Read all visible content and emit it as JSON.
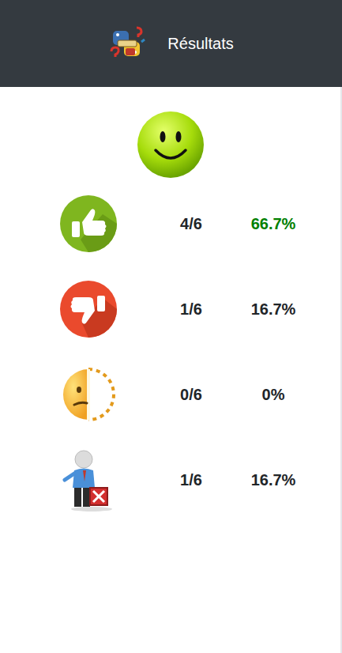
{
  "header": {
    "title": "Résultats"
  },
  "rows": [
    {
      "kind": "correct",
      "score": "4/6",
      "percent": "66.7%",
      "highlighted": true
    },
    {
      "kind": "wrong",
      "score": "1/6",
      "percent": "16.7%",
      "highlighted": false
    },
    {
      "kind": "unanswered",
      "score": "0/6",
      "percent": "0%",
      "highlighted": false
    },
    {
      "kind": "skipped",
      "score": "1/6",
      "percent": "16.7%",
      "highlighted": false
    }
  ]
}
